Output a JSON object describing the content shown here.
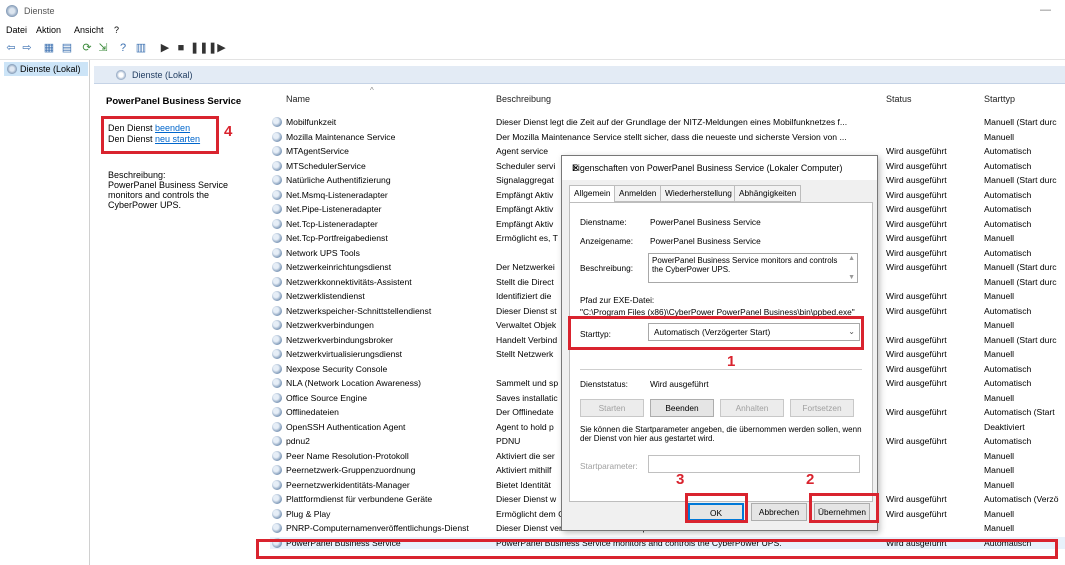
{
  "window": {
    "title": "Dienste"
  },
  "menu": [
    "Datei",
    "Aktion",
    "Ansicht",
    "?"
  ],
  "tree": {
    "node": "Dienste (Lokal)"
  },
  "band": {
    "title": "Dienste (Lokal)"
  },
  "sidepanel": {
    "service_name": "PowerPanel Business Service",
    "stop_prefix": "Den Dienst ",
    "stop_link": "beenden",
    "restart_prefix": "Den Dienst ",
    "restart_link": "neu starten",
    "desc_label": "Beschreibung:",
    "desc_text": "PowerPanel Business Service monitors and controls the CyberPower UPS."
  },
  "columns": {
    "name": "Name",
    "desc": "Beschreibung",
    "status": "Status",
    "start": "Starttyp"
  },
  "rows": [
    {
      "name": "Mobilfunkzeit",
      "desc": "Dieser Dienst legt die Zeit auf der Grundlage der NITZ-Meldungen eines Mobilfunknetzes f...",
      "status": "",
      "start": "Manuell (Start durc"
    },
    {
      "name": "Mozilla Maintenance Service",
      "desc": "Der Mozilla Maintenance Service stellt sicher, dass die neueste und sicherste Version von ...",
      "status": "",
      "start": "Manuell"
    },
    {
      "name": "MTAgentService",
      "desc": "Agent service",
      "status": "Wird ausgeführt",
      "start": "Automatisch"
    },
    {
      "name": "MTSchedulerService",
      "desc": "Scheduler servi",
      "status": "Wird ausgeführt",
      "start": "Automatisch"
    },
    {
      "name": "Natürliche Authentifizierung",
      "desc": "Signalaggregat",
      "status": "Wird ausgeführt",
      "start": "Manuell (Start durc"
    },
    {
      "name": "Net.Msmq-Listeneradapter",
      "desc": "Empfängt Aktiv",
      "status": "Wird ausgeführt",
      "start": "Automatisch"
    },
    {
      "name": "Net.Pipe-Listeneradapter",
      "desc": "Empfängt Aktiv",
      "status": "Wird ausgeführt",
      "start": "Automatisch"
    },
    {
      "name": "Net.Tcp-Listeneradapter",
      "desc": "Empfängt Aktiv",
      "status": "Wird ausgeführt",
      "start": "Automatisch"
    },
    {
      "name": "Net.Tcp-Portfreigabedienst",
      "desc": "Ermöglicht es, T",
      "status": "Wird ausgeführt",
      "start": "Manuell"
    },
    {
      "name": "Network UPS Tools",
      "desc": "",
      "status": "Wird ausgeführt",
      "start": "Automatisch"
    },
    {
      "name": "Netzwerkeinrichtungsdienst",
      "desc": "Der Netzwerkei",
      "status": "Wird ausgeführt",
      "start": "Manuell (Start durc"
    },
    {
      "name": "Netzwerkkonnektivitäts-Assistent",
      "desc": "Stellt die Direct",
      "status": "",
      "start": "Manuell (Start durc"
    },
    {
      "name": "Netzwerklistendienst",
      "desc": "Identifiziert die",
      "status": "Wird ausgeführt",
      "start": "Manuell"
    },
    {
      "name": "Netzwerkspeicher-Schnittstellendienst",
      "desc": "Dieser Dienst st",
      "status": "Wird ausgeführt",
      "start": "Automatisch"
    },
    {
      "name": "Netzwerkverbindungen",
      "desc": "Verwaltet Objek",
      "status": "",
      "start": "Manuell"
    },
    {
      "name": "Netzwerkverbindungsbroker",
      "desc": "Handelt Verbind",
      "status": "Wird ausgeführt",
      "start": "Manuell (Start durc"
    },
    {
      "name": "Netzwerkvirtualisierungsdienst",
      "desc": "Stellt Netzwerk",
      "status": "Wird ausgeführt",
      "start": "Manuell"
    },
    {
      "name": "Nexpose Security Console",
      "desc": "",
      "status": "Wird ausgeführt",
      "start": "Automatisch"
    },
    {
      "name": "NLA (Network Location Awareness)",
      "desc": "Sammelt und sp",
      "status": "Wird ausgeführt",
      "start": "Automatisch"
    },
    {
      "name": "Office  Source Engine",
      "desc": "Saves installatic",
      "status": "",
      "start": "Manuell"
    },
    {
      "name": "Offlinedateien",
      "desc": "Der Offlinedate",
      "status": "Wird ausgeführt",
      "start": "Automatisch (Start"
    },
    {
      "name": "OpenSSH Authentication Agent",
      "desc": "Agent to hold p",
      "status": "",
      "start": "Deaktiviert"
    },
    {
      "name": "pdnu2",
      "desc": "PDNU",
      "status": "Wird ausgeführt",
      "start": "Automatisch"
    },
    {
      "name": "Peer Name Resolution-Protokoll",
      "desc": "Aktiviert die ser",
      "status": "",
      "start": "Manuell"
    },
    {
      "name": "Peernetzwerk-Gruppenzuordnung",
      "desc": "Aktiviert mithilf",
      "status": "",
      "start": "Manuell"
    },
    {
      "name": "Peernetzwerkidentitäts-Manager",
      "desc": "Bietet Identität",
      "status": "",
      "start": "Manuell"
    },
    {
      "name": "Plattformdienst für verbundene Geräte",
      "desc": "Dieser Dienst w",
      "status": "Wird ausgeführt",
      "start": "Automatisch (Verzö"
    },
    {
      "name": "Plug & Play",
      "desc": "Ermöglicht dem Computer, Hardwareänderungen zu erkennen und sich ohne oder mit geri",
      "status": "Wird ausgeführt",
      "start": "Manuell"
    },
    {
      "name": "PNRP-Computernamenveröffentlichungs-Dienst",
      "desc": "Dieser Dienst veröffentlicht einen Computernamen mit dem Peer Name Resolution-Proto",
      "status": "",
      "start": "Manuell"
    },
    {
      "name": "PowerPanel Business Service",
      "desc": "PowerPanel Business Service monitors and controls the CyberPower UPS.",
      "status": "Wird ausgeführt",
      "start": "Automatisch"
    }
  ],
  "dialog": {
    "title": "Eigenschaften von PowerPanel Business Service (Lokaler Computer)",
    "tabs": [
      "Allgemein",
      "Anmelden",
      "Wiederherstellung",
      "Abhängigkeiten"
    ],
    "dienstname_label": "Dienstname:",
    "dienstname_value": "PowerPanel Business Service",
    "anzeigename_label": "Anzeigename:",
    "anzeigename_value": "PowerPanel Business Service",
    "beschreibung_label": "Beschreibung:",
    "beschreibung_value": "PowerPanel Business Service monitors and controls the CyberPower UPS.",
    "pfad_label": "Pfad zur EXE-Datei:",
    "pfad_value": "\"C:\\Program Files (x86)\\CyberPower PowerPanel Business\\bin\\ppbed.exe\"",
    "starttyp_label": "Starttyp:",
    "starttyp_value": "Automatisch (Verzögerter Start)",
    "status_label": "Dienststatus:",
    "status_value": "Wird ausgeführt",
    "btn_starten": "Starten",
    "btn_beenden": "Beenden",
    "btn_anhalten": "Anhalten",
    "btn_fortsetzen": "Fortsetzen",
    "hint": "Sie können die Startparameter angeben, die übernommen werden sollen, wenn der Dienst von hier aus gestartet wird.",
    "startparam_placeholder": "Startparameter:",
    "btn_ok": "OK",
    "btn_abbrechen": "Abbrechen",
    "btn_uebernehmen": "Übernehmen"
  },
  "annotations": {
    "n1": "1",
    "n2": "2",
    "n3": "3",
    "n4": "4",
    "color": "#d9232e"
  }
}
